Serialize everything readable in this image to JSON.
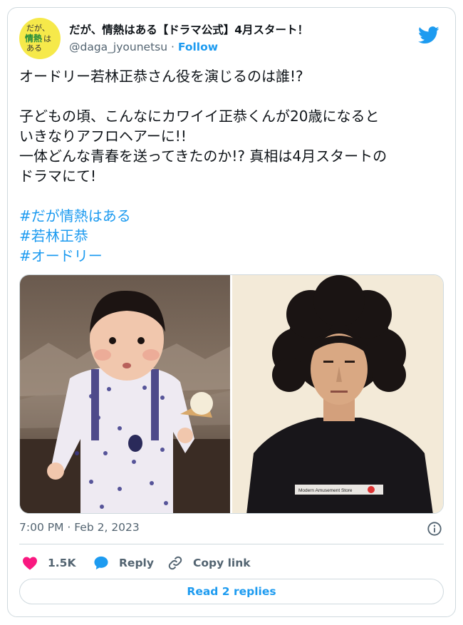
{
  "author": {
    "avatar_text": {
      "line1": "だが、",
      "line2": "情熱",
      "line2_suffix": "は",
      "line3": "ある"
    },
    "display_name": "だが、情熱はある【ドラマ公式】4月スタート！",
    "handle": "@daga_jyounetsu",
    "separator": "·",
    "follow_label": "Follow"
  },
  "brand": {
    "icon": "twitter-bird-icon",
    "color": "#1d9bf0"
  },
  "tweet": {
    "line1": "オードリー若林正恭さん役を演じるのは誰!?",
    "para2": "子どもの頃、こんなにカワイイ正恭くんが20歳になると\nいきなりアフロヘアーに!!\n一体どんな青春を送ってきたのか!? 真相は4月スタートの\nドラマにて!",
    "hashtags": [
      "#だが情熱はある",
      "#若林正恭",
      "#オードリー"
    ]
  },
  "media": {
    "left_photo": "toddler-photo",
    "right_photo": "young-man-afro-photo",
    "shirt_print": "Modern Amusement Store"
  },
  "meta": {
    "timestamp": "7:00 PM · Feb 2, 2023"
  },
  "actions": {
    "like_count": "1.5K",
    "reply_label": "Reply",
    "copy_label": "Copy link"
  },
  "read_replies_label": "Read 2 replies",
  "colors": {
    "like": "#f91880",
    "reply": "#1d9bf0",
    "link": "#1d9bf0",
    "muted": "#536471",
    "border": "#cfd9de"
  }
}
